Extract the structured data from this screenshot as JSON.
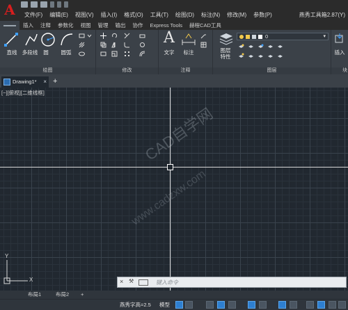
{
  "app": {
    "logo": "A"
  },
  "menu": [
    "文件(F)",
    "编辑(E)",
    "视图(V)",
    "插入(I)",
    "格式(O)",
    "工具(T)",
    "绘图(D)",
    "标注(N)",
    "修改(M)",
    "参数(P)"
  ],
  "brand_menu": "燕秀工具箱2.87(Y)",
  "ribbon_tabs": [
    "默认",
    "插入",
    "注释",
    "参数化",
    "视图",
    "管理",
    "输出",
    "协作",
    "Express Tools",
    "赫程CAD工具"
  ],
  "ribbon": {
    "draw": {
      "title": "绘图",
      "line": "直线",
      "polyline": "多段线",
      "circle": "圆",
      "arc": "圆弧"
    },
    "modify": {
      "title": "修改"
    },
    "annotation": {
      "title": "注释",
      "text": "文字",
      "dimension": "标注"
    },
    "layers": {
      "title": "图层",
      "layer_props": "图层\n特性",
      "layer_props_l1": "图层",
      "layer_props_l2": "特性",
      "current_layer": "0"
    },
    "insert": {
      "label": "插入",
      "block_title": "块"
    }
  },
  "file_tab": {
    "name": "Drawing1*",
    "add": "+"
  },
  "viewport_label": "[−][俯视][二维线框]",
  "watermark": {
    "line1": "CAD自学网",
    "line2": "www.cadzxw.com"
  },
  "ucs": {
    "x": "X",
    "y": "Y"
  },
  "command_line": {
    "placeholder": "键入命令"
  },
  "layout_tabs": [
    "布局1",
    "布局2",
    "+"
  ],
  "status": {
    "text_height": "燕秀字高=2.5",
    "model": "模型"
  },
  "colors": {
    "logo_red": "#d81e1e",
    "accent_blue": "#2e7fd0",
    "canvas": "#212830"
  },
  "icons": [
    "line-icon",
    "polyline-icon",
    "circle-icon",
    "arc-icon",
    "move-icon",
    "text-icon",
    "dimension-icon",
    "layer-icon",
    "insert-icon"
  ]
}
